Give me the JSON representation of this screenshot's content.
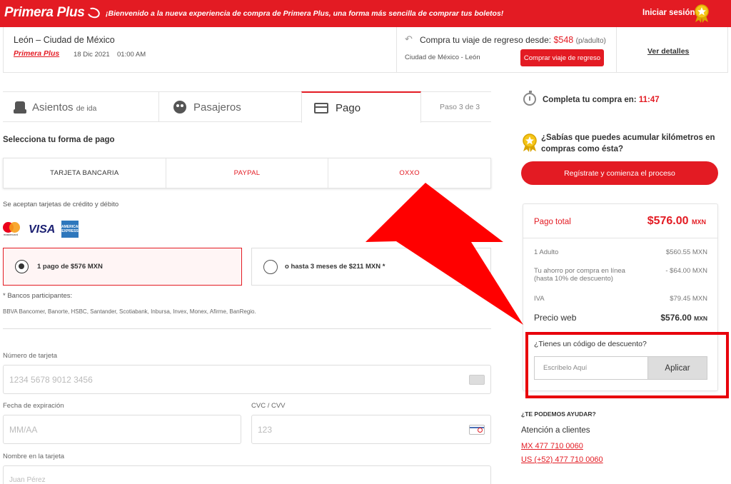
{
  "colors": {
    "brand": "#e31b23",
    "annotation": "#e8000b"
  },
  "topbar": {
    "brand": "Primera Plus",
    "message": "¡Bienvenido a la nueva experiencia de compra de Primera Plus, una forma más sencilla de comprar tus boletos!",
    "login": "Iniciar sesión"
  },
  "trip": {
    "route": "León – Ciudad de México",
    "brand": "Primera Plus",
    "date": "18 Dic 2021",
    "time": "01:00 AM",
    "return_label": "Compra tu viaje de regreso desde:",
    "return_price": "$548",
    "return_unit": "(p/adulto)",
    "return_route": "Ciudad de México - León",
    "return_button": "Comprar viaje de regreso",
    "details_link": "Ver detalles"
  },
  "tabs": [
    {
      "label": "Asientos",
      "sub": "de ida",
      "icon": "seat-icon"
    },
    {
      "label": "Pasajeros",
      "icon": "passengers-icon"
    },
    {
      "label": "Pago",
      "icon": "credit-card-icon"
    }
  ],
  "step_label": "Paso 3 de 3",
  "payment": {
    "section_title": "Selecciona tu forma de pago",
    "methods": [
      "TARJETA BANCARIA",
      "PAYPAL",
      "OXXO"
    ],
    "cards_note": "Se aceptan tarjetas de crédito y débito",
    "card_brands": [
      "Mastercard",
      "VISA",
      "American Express"
    ],
    "mastercard_caption": "mastercard",
    "amex_caption": "AMERICAN EXPRESS",
    "options": [
      "1 pago de $576 MXN",
      "o hasta 3 meses de $211 MXN *"
    ],
    "banks_title": "* Bancos participantes:",
    "banks_list": "BBVA Bancomer, Banorte, HSBC, Santander, Scotiabank, Inbursa, Invex, Monex, Afirme, BanRegio."
  },
  "form": {
    "card_number_label": "Número de tarjeta",
    "card_number_placeholder": "1234 5678 9012 3456",
    "expiry_label": "Fecha de expiración",
    "expiry_placeholder": "MM/AA",
    "cvc_label": "CVC / CVV",
    "cvc_placeholder": "123",
    "name_label": "Nombre en la tarjeta",
    "name_placeholder": "Juan Pérez"
  },
  "sidebar": {
    "timer_label": "Completa tu compra en:",
    "timer_value": "11:47",
    "km_text": "¿Sabías que puedes acumular kilómetros en compras como ésta?",
    "register_button": "Regístrate y comienza el proceso",
    "summary": {
      "title": "Pago total",
      "total": "$576.00",
      "currency": "MXN",
      "rows": [
        {
          "label": "1 Adulto",
          "value": "$560.55 MXN"
        },
        {
          "label": "Tu ahorro por compra en línea",
          "label2": "(hasta 10% de descuento)",
          "value": "- $64.00 MXN"
        },
        {
          "label": "IVA",
          "value": "$79.45 MXN"
        }
      ],
      "web_label": "Precio web",
      "web_value": "$576.00",
      "web_currency": "MXN"
    },
    "discount": {
      "label": "¿Tienes un código de descuento?",
      "placeholder": "Escríbelo Aquí",
      "button": "Aplicar"
    },
    "help": {
      "title": "¿TE PODEMOS AYUDAR?",
      "subtitle": "Atención a clientes",
      "phone_mx": "MX 477 710 0060",
      "phone_us": "US (+52) 477 710 0060"
    }
  }
}
